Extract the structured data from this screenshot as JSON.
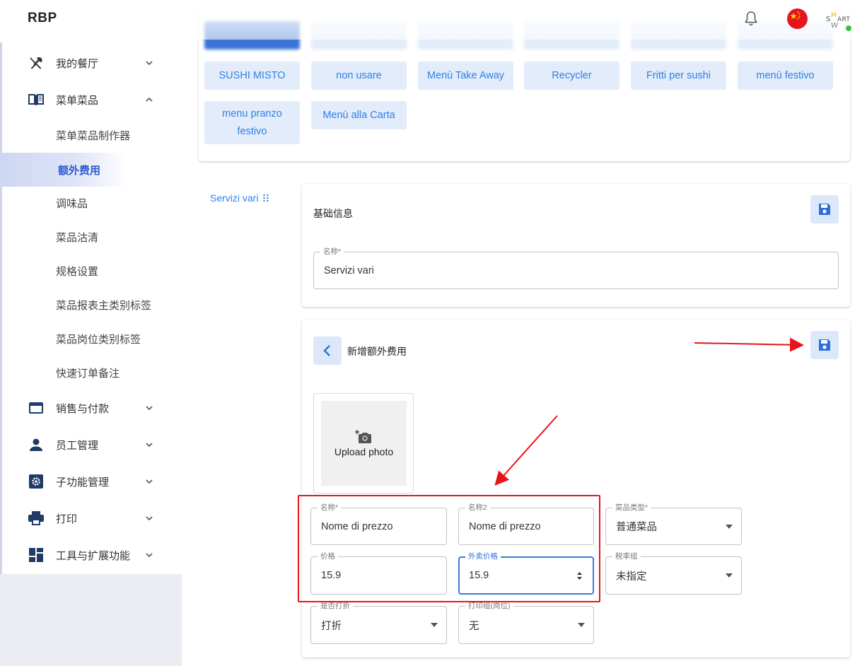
{
  "app": {
    "brand": "RBP"
  },
  "sidebar": {
    "items": [
      {
        "label": "我的餐厅",
        "icon": "fork-knife-icon"
      },
      {
        "label": "菜单菜品",
        "icon": "menu-book-icon"
      },
      {
        "label": "销售与付款",
        "icon": "credit-card-icon"
      },
      {
        "label": "员工管理",
        "icon": "person-icon"
      },
      {
        "label": "子功能管理",
        "icon": "settings-box-icon"
      },
      {
        "label": "打印",
        "icon": "printer-icon"
      },
      {
        "label": "工具与扩展功能",
        "icon": "dashboard-icon"
      }
    ],
    "subitems": [
      {
        "label": "菜单菜品制作器"
      },
      {
        "label": "额外费用",
        "active": true
      },
      {
        "label": "调味品"
      },
      {
        "label": "菜品沽清"
      },
      {
        "label": "规格设置"
      },
      {
        "label": "菜品报表主类别标签"
      },
      {
        "label": "菜品岗位类别标签"
      },
      {
        "label": "快速订单备注"
      }
    ]
  },
  "menus": {
    "row2": [
      "SUSHI MISTO",
      "non usare",
      "Menù Take Away",
      "Recycler",
      "Fritti per sushi",
      "menù festivo"
    ],
    "row3": [
      "menu pranzo festivo",
      "Menù alla Carta"
    ]
  },
  "left_section": {
    "label": "Servizi vari"
  },
  "basic_info": {
    "title": "基础信息",
    "name_label": "名称*",
    "name_value": "Servizi vari"
  },
  "new_extra": {
    "title": "新增额外费用",
    "upload_label": "Upload photo",
    "fields": {
      "name": {
        "label": "名称*",
        "value": "Nome di prezzo"
      },
      "name2": {
        "label": "名称2",
        "value": "Nome di prezzo"
      },
      "dish_type": {
        "label": "菜品类型*",
        "value": "普通菜品"
      },
      "price": {
        "label": "价格",
        "value": "15.9"
      },
      "takeaway_price": {
        "label": "外卖价格",
        "value": "15.9"
      },
      "tax_group": {
        "label": "税率组",
        "value": "未指定"
      },
      "discount": {
        "label": "是否打折",
        "value": "打折"
      },
      "print_group": {
        "label": "打印组(岗位)",
        "value": "无"
      }
    }
  },
  "colors": {
    "accent": "#2f80e8",
    "chip_bg": "#e2ecfa",
    "annotation": "#e8141c",
    "sidebar_bg": "#ebedf2"
  }
}
